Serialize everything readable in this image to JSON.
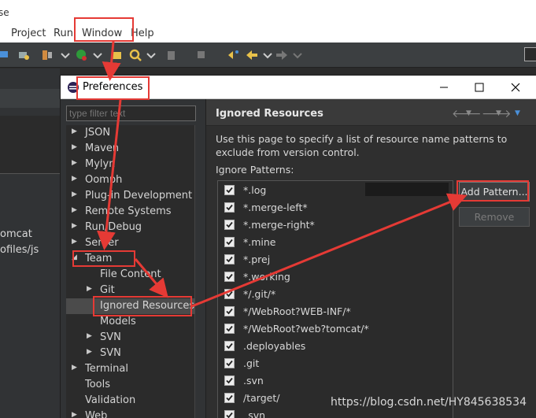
{
  "app": {
    "title_fragment": "se"
  },
  "menubar": {
    "items": [
      "Project",
      "Run",
      "Window",
      "Help"
    ]
  },
  "workspace": {
    "lines": [
      "omcat",
      "ofiles/js"
    ]
  },
  "dialog": {
    "title": "Preferences",
    "filter_placeholder": "type filter text",
    "tree": [
      {
        "label": "JSON",
        "level": 0,
        "arrow": "▶"
      },
      {
        "label": "Maven",
        "level": 0,
        "arrow": "▶"
      },
      {
        "label": "Mylyn",
        "level": 0,
        "arrow": "▶"
      },
      {
        "label": "Oomph",
        "level": 0,
        "arrow": "▶"
      },
      {
        "label": "Plug-in Development",
        "level": 0,
        "arrow": "▶"
      },
      {
        "label": "Remote Systems",
        "level": 0,
        "arrow": "▶"
      },
      {
        "label": "Run/Debug",
        "level": 0,
        "arrow": "▶"
      },
      {
        "label": "Server",
        "level": 0,
        "arrow": "▶"
      },
      {
        "label": "Team",
        "level": 0,
        "arrow": "◢"
      },
      {
        "label": "File Content",
        "level": 1,
        "arrow": ""
      },
      {
        "label": "Git",
        "level": 1,
        "arrow": "▶"
      },
      {
        "label": "Ignored Resources",
        "level": 1,
        "arrow": "",
        "selected": true
      },
      {
        "label": "Models",
        "level": 1,
        "arrow": ""
      },
      {
        "label": "SVN",
        "level": 1,
        "arrow": "▶"
      },
      {
        "label": "SVN",
        "level": 1,
        "arrow": "▶"
      },
      {
        "label": "Terminal",
        "level": 0,
        "arrow": "▶"
      },
      {
        "label": "Tools",
        "level": 0,
        "arrow": ""
      },
      {
        "label": "Validation",
        "level": 0,
        "arrow": ""
      },
      {
        "label": "Web",
        "level": 0,
        "arrow": "▶"
      }
    ],
    "page": {
      "title": "Ignored Resources",
      "description": "Use this page to specify a list of resource name patterns to exclude from version control.",
      "patterns_label": "Ignore Patterns:",
      "patterns": [
        {
          "label": "*.log",
          "checked": true
        },
        {
          "label": "*.merge-left*",
          "checked": true
        },
        {
          "label": "*.merge-right*",
          "checked": true
        },
        {
          "label": "*.mine",
          "checked": true
        },
        {
          "label": "*.prej",
          "checked": true
        },
        {
          "label": "*.working",
          "checked": true
        },
        {
          "label": "*/.git/*",
          "checked": true
        },
        {
          "label": "*/WebRoot?WEB-INF/*",
          "checked": true
        },
        {
          "label": "*/WebRoot?web?tomcat/*",
          "checked": true
        },
        {
          "label": ".deployables",
          "checked": true
        },
        {
          "label": ".git",
          "checked": true
        },
        {
          "label": ".svn",
          "checked": true
        },
        {
          "label": "/target/",
          "checked": true
        },
        {
          "label": "_svn",
          "checked": true
        }
      ],
      "add_button": "Add Pattern...",
      "remove_button": "Remove"
    }
  },
  "watermark": "https://blog.csdn.net/HY845638534",
  "colors": {
    "annotation": "#e53a35",
    "dark_bg": "#2b2b2b"
  }
}
